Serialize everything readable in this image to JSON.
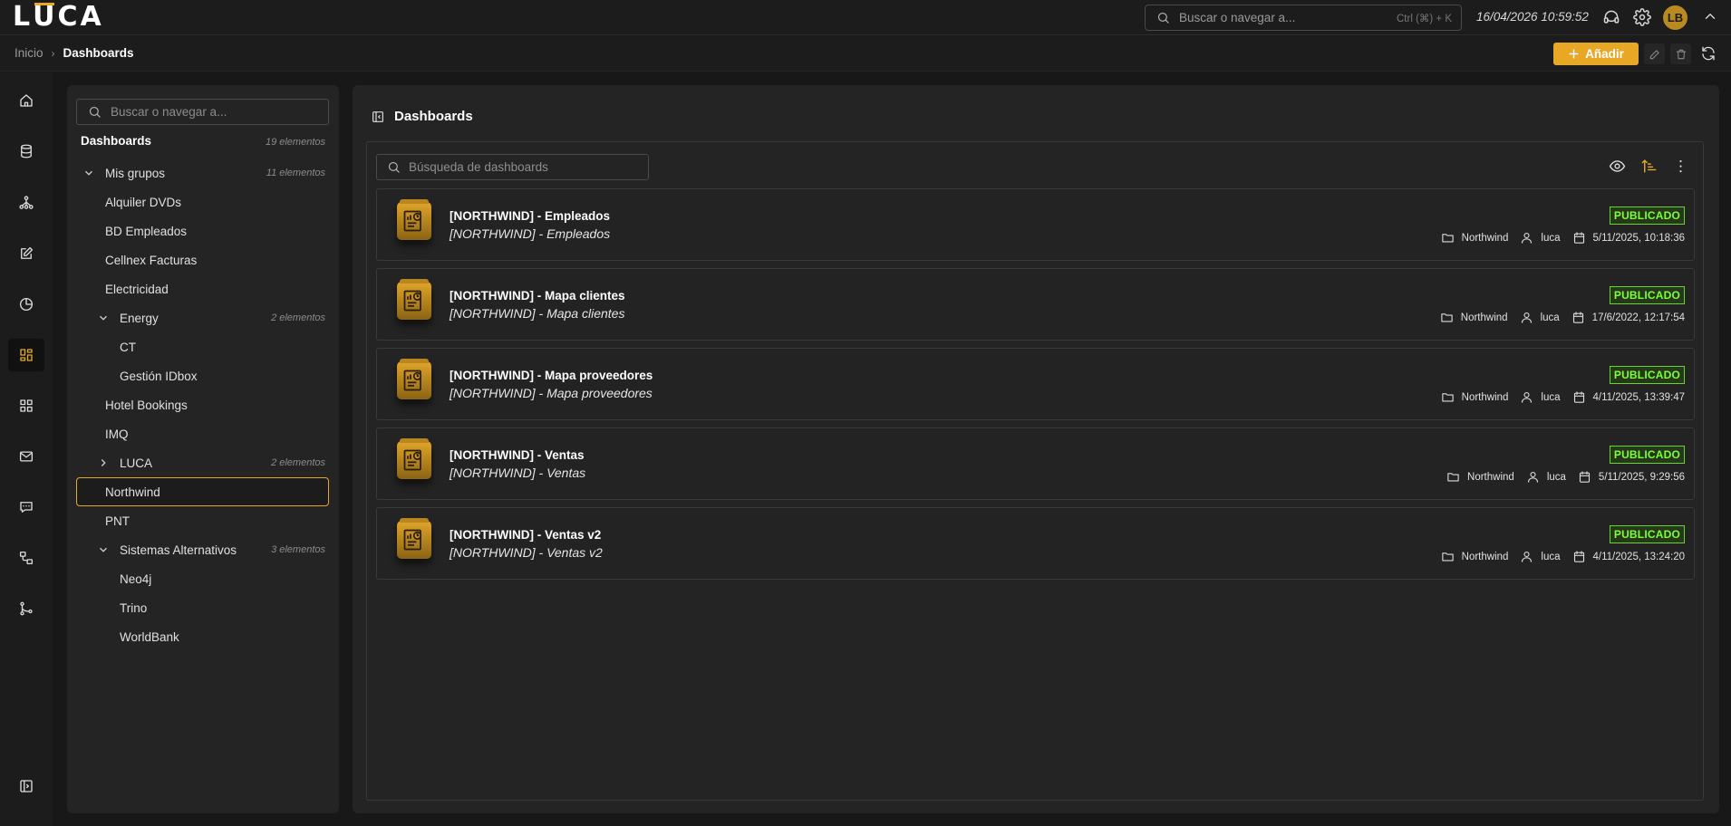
{
  "app": {
    "logo": "LUCA"
  },
  "topbar": {
    "search_placeholder": "Buscar o navegar a...",
    "shortcut": "Ctrl (⌘) + K",
    "datetime": "16/04/2026 10:59:52",
    "avatar_initials": "LB"
  },
  "breadcrumb": {
    "home": "Inicio",
    "current": "Dashboards"
  },
  "actions": {
    "add_label": "Añadir"
  },
  "tree": {
    "search_placeholder": "Buscar o navegar a...",
    "root_label": "Dashboards",
    "root_count": "19 elementos",
    "items": [
      {
        "label": "Mis grupos",
        "count": "11 elementos",
        "level": 0,
        "expand": "down"
      },
      {
        "label": "Alquiler DVDs",
        "count": "",
        "level": 1,
        "expand": ""
      },
      {
        "label": "BD Empleados",
        "count": "",
        "level": 1,
        "expand": ""
      },
      {
        "label": "Cellnex Facturas",
        "count": "",
        "level": 1,
        "expand": ""
      },
      {
        "label": "Electricidad",
        "count": "",
        "level": 1,
        "expand": ""
      },
      {
        "label": "Energy",
        "count": "2 elementos",
        "level": 1,
        "expand": "down"
      },
      {
        "label": "CT",
        "count": "",
        "level": 2,
        "expand": ""
      },
      {
        "label": "Gestión IDbox",
        "count": "",
        "level": 2,
        "expand": ""
      },
      {
        "label": "Hotel Bookings",
        "count": "",
        "level": 1,
        "expand": ""
      },
      {
        "label": "IMQ",
        "count": "",
        "level": 1,
        "expand": ""
      },
      {
        "label": "LUCA",
        "count": "2 elementos",
        "level": 1,
        "expand": "right"
      },
      {
        "label": "Northwind",
        "count": "",
        "level": 1,
        "expand": "",
        "selected": true
      },
      {
        "label": "PNT",
        "count": "",
        "level": 1,
        "expand": ""
      },
      {
        "label": "Sistemas Alternativos",
        "count": "3 elementos",
        "level": 1,
        "expand": "down"
      },
      {
        "label": "Neo4j",
        "count": "",
        "level": 2,
        "expand": ""
      },
      {
        "label": "Trino",
        "count": "",
        "level": 2,
        "expand": ""
      },
      {
        "label": "WorldBank",
        "count": "",
        "level": 2,
        "expand": ""
      }
    ]
  },
  "main": {
    "title": "Dashboards",
    "search_placeholder": "Búsqueda de dashboards",
    "cards": [
      {
        "title": "[NORTHWIND] - Empleados",
        "subtitle": "[NORTHWIND] - Empleados",
        "status": "PUBLICADO",
        "folder": "Northwind",
        "user": "luca",
        "date": "5/11/2025, 10:18:36"
      },
      {
        "title": "[NORTHWIND] - Mapa clientes",
        "subtitle": "[NORTHWIND] - Mapa clientes",
        "status": "PUBLICADO",
        "folder": "Northwind",
        "user": "luca",
        "date": "17/6/2022, 12:17:54"
      },
      {
        "title": "[NORTHWIND] - Mapa proveedores",
        "subtitle": "[NORTHWIND] - Mapa proveedores",
        "status": "PUBLICADO",
        "folder": "Northwind",
        "user": "luca",
        "date": "4/11/2025, 13:39:47"
      },
      {
        "title": "[NORTHWIND] - Ventas",
        "subtitle": "[NORTHWIND] - Ventas",
        "status": "PUBLICADO",
        "folder": "Northwind",
        "user": "luca",
        "date": "5/11/2025, 9:29:56"
      },
      {
        "title": "[NORTHWIND] - Ventas v2",
        "subtitle": "[NORTHWIND] - Ventas v2",
        "status": "PUBLICADO",
        "folder": "Northwind",
        "user": "luca",
        "date": "4/11/2025, 13:24:20"
      }
    ]
  },
  "rail": {
    "items": [
      {
        "icon": "home-icon"
      },
      {
        "icon": "database-icon"
      },
      {
        "icon": "network-icon"
      },
      {
        "icon": "edit-icon"
      },
      {
        "icon": "pie-chart-icon"
      },
      {
        "icon": "dashboard-icon",
        "active": true
      },
      {
        "icon": "grid-icon"
      },
      {
        "icon": "mail-icon"
      },
      {
        "icon": "chat-icon"
      },
      {
        "icon": "workflow-icon"
      },
      {
        "icon": "git-branch-icon"
      }
    ],
    "bottom_icon": "collapse-panel-icon"
  },
  "colors": {
    "accent": "#e8a826",
    "status_published": "#7cff35",
    "background": "#181818",
    "panel": "#242424"
  }
}
